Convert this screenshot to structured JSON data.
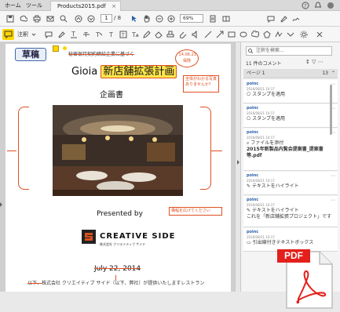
{
  "tabs": {
    "home": "ホーム",
    "tools": "ツール",
    "document": "Products2015.pdf",
    "document_close": "×"
  },
  "toolbar": {
    "page_current": "1",
    "page_total": "/ 8",
    "zoom": "69%"
  },
  "comment_toolbar": {
    "label": "注釈",
    "accent": "#ffd500"
  },
  "document": {
    "stamp": "草稿",
    "confidential_note": "秘密保持契約締結企業に基づく",
    "date_stamp_line1": "'14.06.21",
    "date_stamp_line2": "保険",
    "title_prefix": "Gioia",
    "title_highlight": "新店舗拡張計画",
    "callout_photo": "全体がわかる写真ありませんか？",
    "subtitle": "企画書",
    "callout_enlarge": "構幅を広げてください",
    "presented_by": "Presented by",
    "logo_name": "CREATIVE SIDE",
    "logo_sub": "株式会社 クリエイティブ サイド",
    "date_strike": "July 22, 2014",
    "bottom_strike": "以下、",
    "bottom_text": "株式会社 クリエイティブ サイド（以下、弊社）が提供いたしますレストラン"
  },
  "comments_pane": {
    "search_placeholder": "注釈を検索...",
    "count": "11 件のコメント",
    "page_label": "ページ 1",
    "page_count": "13",
    "items": [
      {
        "author": "poinc",
        "date": "2016/08/21 10:17",
        "text": "スタンプを適用"
      },
      {
        "author": "poinc",
        "date": "2016/08/21 10:17",
        "text": "スタンプを適用"
      },
      {
        "author": "poinc",
        "date": "2016/08/21 10:17",
        "text": "ファイルを添付"
      },
      {
        "author": "",
        "date": "",
        "text": "2015年新製品内覧会提案書_提案書等.pdf"
      },
      {
        "author": "poinc",
        "date": "2016/08/21 10:17",
        "text": "テキストをハイライト"
      },
      {
        "author": "poinc",
        "date": "2016/08/21 10:17",
        "text": "テキストをハイライト"
      },
      {
        "author": "",
        "date": "",
        "text": "これを「新店舗拡張プロジェクト」です"
      },
      {
        "author": "poinc",
        "date": "2016/08/21 10:17",
        "text": "引出線付きテキストボックス"
      }
    ]
  },
  "pdf_logo": {
    "label": "PDF",
    "color": "#e3201b"
  }
}
